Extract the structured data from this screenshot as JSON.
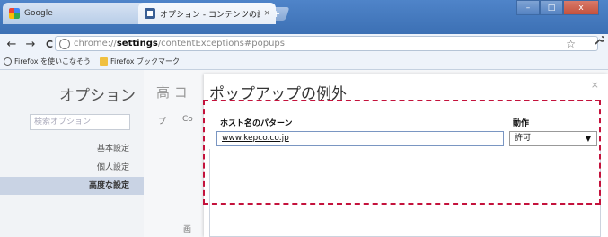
{
  "tabs": [
    {
      "label": "Google",
      "favicon": "google-icon"
    },
    {
      "label": "オプション - コンテンツの設定",
      "favicon": "settings-page-icon"
    }
  ],
  "tab_close_glyph": "×",
  "new_tab_glyph": "+",
  "window_controls": {
    "minimize": "–",
    "maximize": "□",
    "close": "x"
  },
  "toolbar": {
    "back": "←",
    "forward": "→",
    "reload": "C",
    "url_scheme": "chrome://",
    "url_host": "settings",
    "url_path": "/contentExceptions#popups",
    "star": "☆",
    "wrench": "🔧"
  },
  "bookmarks": [
    {
      "label": "Firefox を使いこなそう",
      "icon": "circle-icon"
    },
    {
      "label": "Firefox ブックマーク",
      "icon": "folder-icon"
    }
  ],
  "sidebar": {
    "title": "オプション",
    "search_placeholder": "検索オプション",
    "items": [
      "基本設定",
      "個人設定",
      "高度な設定"
    ],
    "active_index": 2
  },
  "background_text": {
    "heading_fragment": "高 コ",
    "small_1": "プ",
    "small_2": "Co",
    "small_3": "画"
  },
  "dialog": {
    "title": "ポップアップの例外",
    "close_glyph": "×",
    "column_host": "ホスト名のパターン",
    "column_action": "動作",
    "host_value": "www.kepco.co.jp",
    "action_value": "許可",
    "select_arrow": "▼"
  },
  "colors": {
    "highlight_dashed": "#c4123c",
    "title_bar": "#4f84c9",
    "sidebar_active": "#c9d3e4"
  }
}
